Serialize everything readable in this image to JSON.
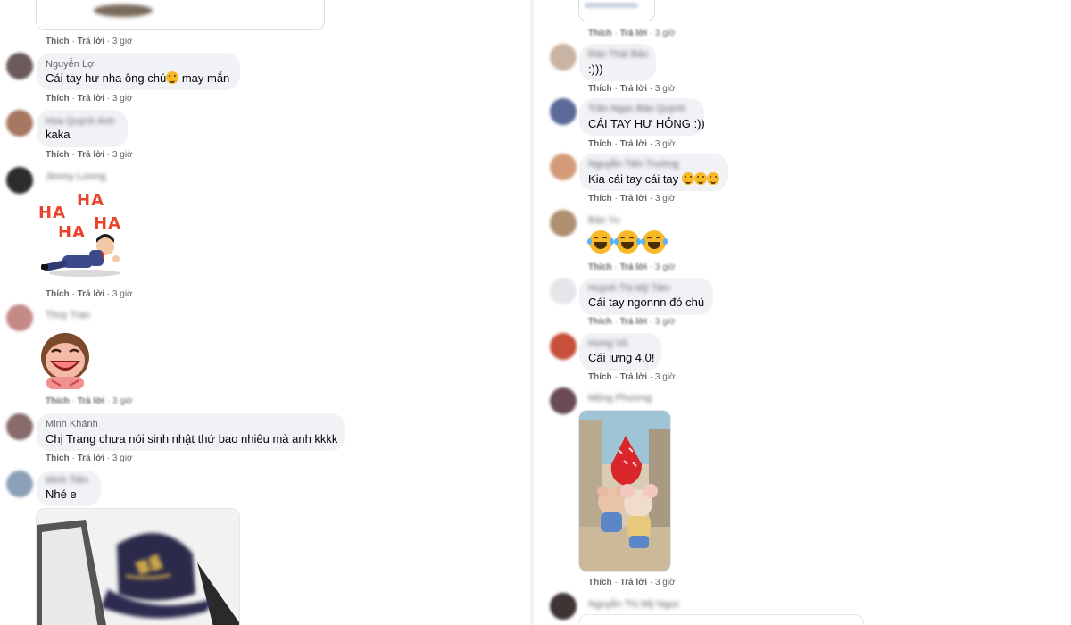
{
  "actions": {
    "like": "Thích",
    "reply": "Trả lời",
    "time": "3 giờ",
    "sep": " · "
  },
  "left": {
    "comments": [
      {
        "name": "Nguyễn Lợi",
        "text_a": "Cái tay hư nha ông chú",
        "text_b": "may mắn",
        "emoji": "laugh-emoji"
      },
      {
        "name": "Hoa Quỳnh Anh",
        "text": "kaka"
      },
      {
        "name": "Jimmy Lương",
        "sticker": "haha-sticker",
        "sticker_text": [
          "HA",
          "HA",
          "HA",
          "HA"
        ]
      },
      {
        "name": "Thuy Tran",
        "sticker": "laughing-sticker"
      },
      {
        "name": "Minh Khánh",
        "text": "Chị Trang chưa nói sinh nhật thứ bao nhiêu mà anh kkkk"
      },
      {
        "name": "Minh Tiến",
        "text": "Nhé e",
        "image": "cap-photo"
      }
    ]
  },
  "right": {
    "comments": [
      {
        "name": "Đào Thái Bảo",
        "text": ":)))"
      },
      {
        "name": "Trần Ngọc Bảo Quỳnh",
        "text": "CÁI TAY HƯ HỎNG :))"
      },
      {
        "name": "Nguyễn Tiến Trường",
        "text": "Kia cái tay cái tay",
        "emoji": "sad-emoji"
      },
      {
        "name": "Bảo Yu",
        "emoji_only": "tears-of-joy-emoji"
      },
      {
        "name": "Huỳnh Thị Mỹ Tiên",
        "text": "Cái tay ngonnn đó chú"
      },
      {
        "name": "Hưng Vũ",
        "text": "Cái lưng 4.0!"
      },
      {
        "name": "Mộng Phương",
        "image": "mouse-sticker-photo"
      },
      {
        "name": "Nguyễn Thị Mỹ Ngọc"
      }
    ]
  },
  "colors": {
    "bubble": "#f0f2f5",
    "meta": "#65676b",
    "text": "#050505"
  }
}
